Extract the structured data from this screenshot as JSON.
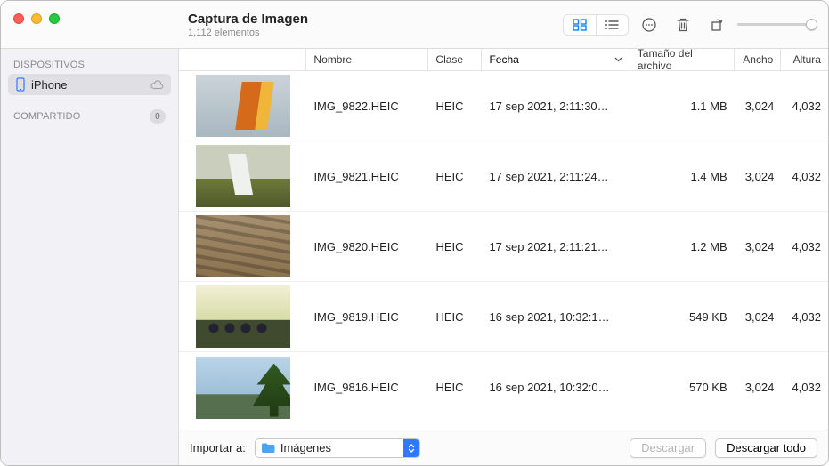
{
  "window": {
    "app_title": "Captura de Imagen",
    "subtitle": "1,112 elementos"
  },
  "sidebar": {
    "devices_header": "DISPOSITIVOS",
    "shared_header": "COMPARTIDO",
    "shared_count": "0",
    "items": [
      {
        "label": "iPhone"
      }
    ]
  },
  "columns": {
    "name": "Nombre",
    "kind": "Clase",
    "date": "Fecha",
    "size": "Tamaño del archivo",
    "width": "Ancho",
    "height": "Altura"
  },
  "rows": [
    {
      "name": "IMG_9822.HEIC",
      "kind": "HEIC",
      "date": "17 sep  2021, 2:11:30…",
      "size": "1.1 MB",
      "width": "3,024",
      "height": "4,032"
    },
    {
      "name": "IMG_9821.HEIC",
      "kind": "HEIC",
      "date": "17 sep 2021, 2:11:24…",
      "size": "1.4 MB",
      "width": "3,024",
      "height": "4,032"
    },
    {
      "name": "IMG_9820.HEIC",
      "kind": "HEIC",
      "date": "17 sep 2021, 2:11:21…",
      "size": "1.2 MB",
      "width": "3,024",
      "height": "4,032"
    },
    {
      "name": "IMG_9819.HEIC",
      "kind": "HEIC",
      "date": "16 sep 2021, 10:32:1…",
      "size": "549 KB",
      "width": "3,024",
      "height": "4,032"
    },
    {
      "name": "IMG_9816.HEIC",
      "kind": "HEIC",
      "date": "16 sep 2021, 10:32:0…",
      "size": "570 KB",
      "width": "3,024",
      "height": "4,032"
    }
  ],
  "footer": {
    "import_label": "Importar a:",
    "destination": "Imágenes",
    "download": "Descargar",
    "download_all": "Descargar todo"
  }
}
